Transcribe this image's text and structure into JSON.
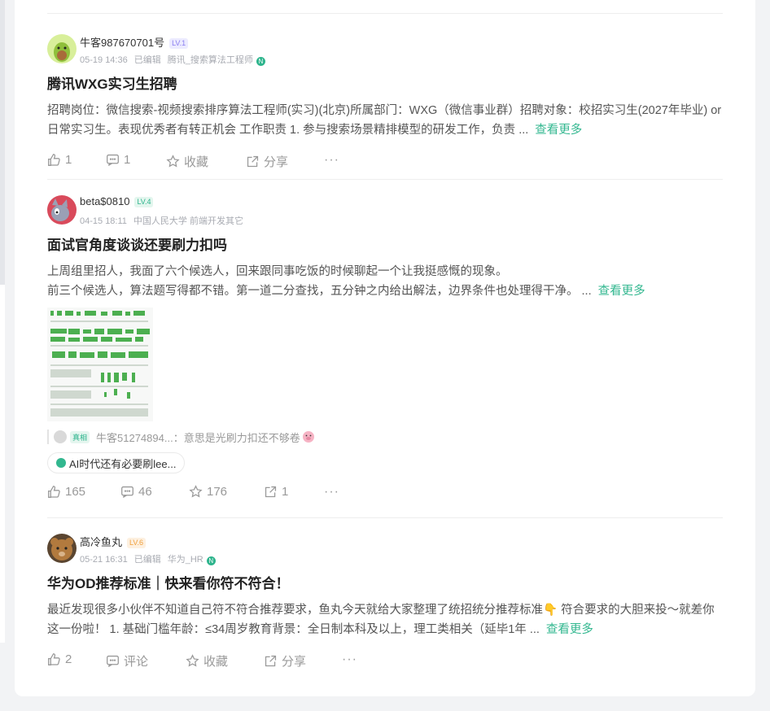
{
  "posts": [
    {
      "user": "牛客987670701号",
      "level": "LV.1",
      "level_colors": {
        "bg": "#ecebff",
        "fg": "#8a7ef0"
      },
      "date": "05-19 14:36",
      "edited": "已编辑",
      "affiliation": "腾讯_搜索算法工程师",
      "badge": "N",
      "title": "腾讯WXG实习生招聘",
      "body": "招聘岗位：微信搜索-视频搜索排序算法工程师(实习)(北京)所属部门：WXG（微信事业群）招聘对象：校招实习生(2027年毕业) or 日常实习生。表现优秀者有转正机会 工作职责 1. 参与搜索场景精排模型的研发工作，负责 ...",
      "more": "查看更多",
      "actions": {
        "like": "1",
        "comment": "1",
        "collect": "收藏",
        "share": "分享",
        "more_icon": "···"
      }
    },
    {
      "user": "beta$0810",
      "level": "LV.4",
      "level_colors": {
        "bg": "#e3f6ee",
        "fg": "#2db48c"
      },
      "date": "04-15 18:11",
      "affiliation": "中国人民大学 前端开发其它",
      "title": "面试官角度谈谈还要刷力扣吗",
      "body_line1": "上周组里招人，我面了六个候选人，回来跟同事吃饭的时候聊起一个让我挺感慨的现象。",
      "body_line2": "前三个候选人，算法题写得都不错。第一道二分查找，五分钟之内给出解法，边界条件也处理得干净。 ...",
      "more": "查看更多",
      "quote": {
        "tag": "真相",
        "user": "牛客51274894...",
        "text": "：意思是光刷力扣还不够卷"
      },
      "topic": "AI时代还有必要刷lee...",
      "actions": {
        "like": "165",
        "comment": "46",
        "collect": "176",
        "share": "1",
        "more_icon": "···"
      }
    },
    {
      "user": "高冷鱼丸",
      "level": "LV.6",
      "level_colors": {
        "bg": "#fdf0e0",
        "fg": "#f0a03c"
      },
      "date": "05-21 16:31",
      "edited": "已编辑",
      "affiliation": "华为_HR",
      "badge": "N",
      "title": "华为OD推荐标准｜快来看你符不符合！",
      "body": "最近发现很多小伙伴不知道自己符不符合推荐要求，鱼丸今天就给大家整理了统招统分推荐标准👇 符合要求的大胆来投～就差你这一份啦！ 1. 基础门槛年龄：≤34周岁教育背景：全日制本科及以上，理工类相关（延毕1年 ...",
      "more": "查看更多",
      "actions": {
        "like": "2",
        "comment": "评论",
        "collect": "收藏",
        "share": "分享",
        "more_icon": "···"
      }
    }
  ],
  "accent_color": "#32b78f"
}
